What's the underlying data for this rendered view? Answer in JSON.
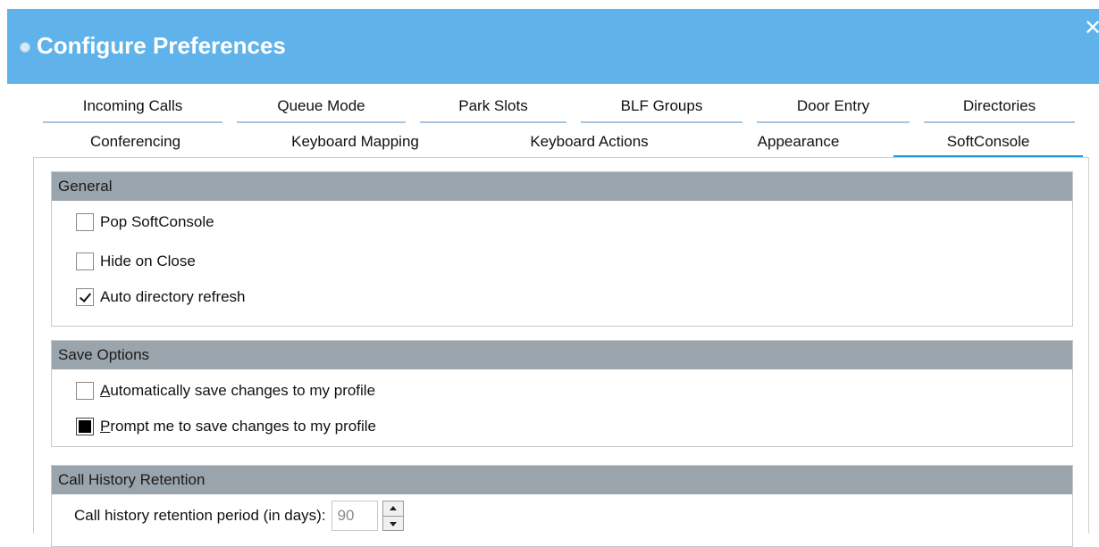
{
  "window": {
    "title": "Configure Preferences",
    "close_label": "✕"
  },
  "tabs": {
    "row1": [
      {
        "label": "Incoming Calls"
      },
      {
        "label": "Queue Mode"
      },
      {
        "label": "Park Slots"
      },
      {
        "label": "BLF Groups"
      },
      {
        "label": "Door Entry"
      },
      {
        "label": "Directories"
      }
    ],
    "row2": [
      {
        "label": "Conferencing"
      },
      {
        "label": "Keyboard Mapping"
      },
      {
        "label": "Keyboard Actions"
      },
      {
        "label": "Appearance"
      },
      {
        "label": "SoftConsole",
        "active": true
      }
    ]
  },
  "general": {
    "header": "General",
    "options": [
      {
        "label": "Pop SoftConsole",
        "checked": false
      },
      {
        "label": "Hide on Close",
        "checked": false
      },
      {
        "label": "Auto directory refresh",
        "checked": true
      }
    ]
  },
  "save_options": {
    "header": "Save Options",
    "auto_save": {
      "mnemonic": "A",
      "rest": "utomatically save changes to my profile",
      "checked": false
    },
    "prompt_save": {
      "mnemonic": "P",
      "rest": "rompt me to save changes to my profile",
      "checked": true
    }
  },
  "call_history": {
    "header": "Call History Retention",
    "label": "Call history retention period (in days):",
    "value": "90"
  },
  "colors": {
    "titlebar": "#5fb3ea",
    "group_header": "#9aa4ad",
    "active_tab_accent": "#1f9ae0"
  }
}
